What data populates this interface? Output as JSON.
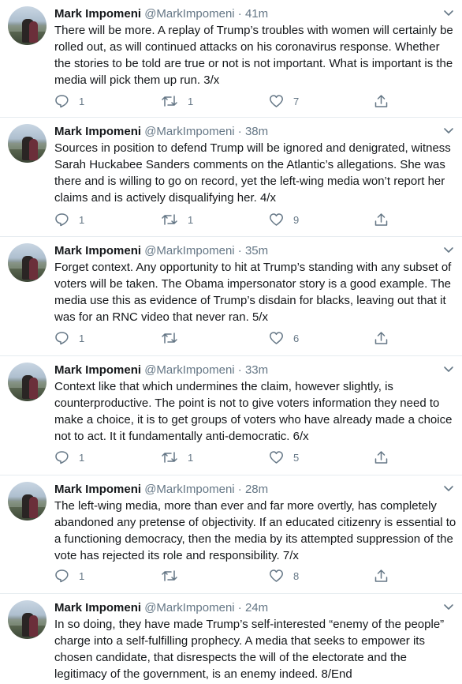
{
  "tweets": [
    {
      "name": "Mark Impomeni",
      "handle": "@MarkImpomeni",
      "time": "41m",
      "text": "There will be more. A replay of Trump’s troubles with women will certainly be rolled out, as will continued attacks on his coronavirus response. Whether the stories to be told are true or not is not important. What is important is the media will pick them up run. 3/x",
      "replies": "1",
      "retweets": "1",
      "likes": "7"
    },
    {
      "name": "Mark Impomeni",
      "handle": "@MarkImpomeni",
      "time": "38m",
      "text": "Sources in position to defend Trump will be ignored and denigrated, witness Sarah Huckabee Sanders comments on the Atlantic’s allegations. She was there and is willing to go on record, yet the left-wing media won’t report her claims and is actively disqualifying her. 4/x",
      "replies": "1",
      "retweets": "1",
      "likes": "9"
    },
    {
      "name": "Mark Impomeni",
      "handle": "@MarkImpomeni",
      "time": "35m",
      "text": "Forget context. Any opportunity to hit at Trump’s standing with any subset of voters will be taken. The Obama impersonator story is a good example. The media use this as evidence of Trump’s disdain for blacks, leaving out that it was for an RNC video that never ran. 5/x",
      "replies": "1",
      "retweets": "",
      "likes": "6"
    },
    {
      "name": "Mark Impomeni",
      "handle": "@MarkImpomeni",
      "time": "33m",
      "text": "Context like that which undermines the claim, however slightly, is counterproductive. The point is not to give voters information they need to make a choice, it is to get groups of voters who have already made a choice not to act. It it fundamentally anti-democratic. 6/x",
      "replies": "1",
      "retweets": "1",
      "likes": "5"
    },
    {
      "name": "Mark Impomeni",
      "handle": "@MarkImpomeni",
      "time": "28m",
      "text": "The left-wing media, more than ever and far more overtly, has completely abandoned any pretense of objectivity. If an educated citizenry is essential to a functioning democracy, then the media by its attempted suppression of the vote has rejected its role and responsibility. 7/x",
      "replies": "1",
      "retweets": "",
      "likes": "8"
    },
    {
      "name": "Mark Impomeni",
      "handle": "@MarkImpomeni",
      "time": "24m",
      "text": "In so doing, they have made Trump’s self-interested “enemy of the people” charge into a self-fulfilling prophecy. A media that seeks to empower its chosen candidate, that disrespects the will of the electorate and the legitimacy of the government, is an enemy indeed. 8/End",
      "replies": "",
      "retweets": "",
      "likes": ""
    }
  ],
  "separator": "·",
  "icons": {
    "reply": "reply-icon",
    "retweet": "retweet-icon",
    "like": "like-icon",
    "share": "share-icon",
    "caret": "chevron-down-icon"
  },
  "colors": {
    "icon": "#657786",
    "text": "#14171a",
    "border": "#e6ecf0"
  }
}
